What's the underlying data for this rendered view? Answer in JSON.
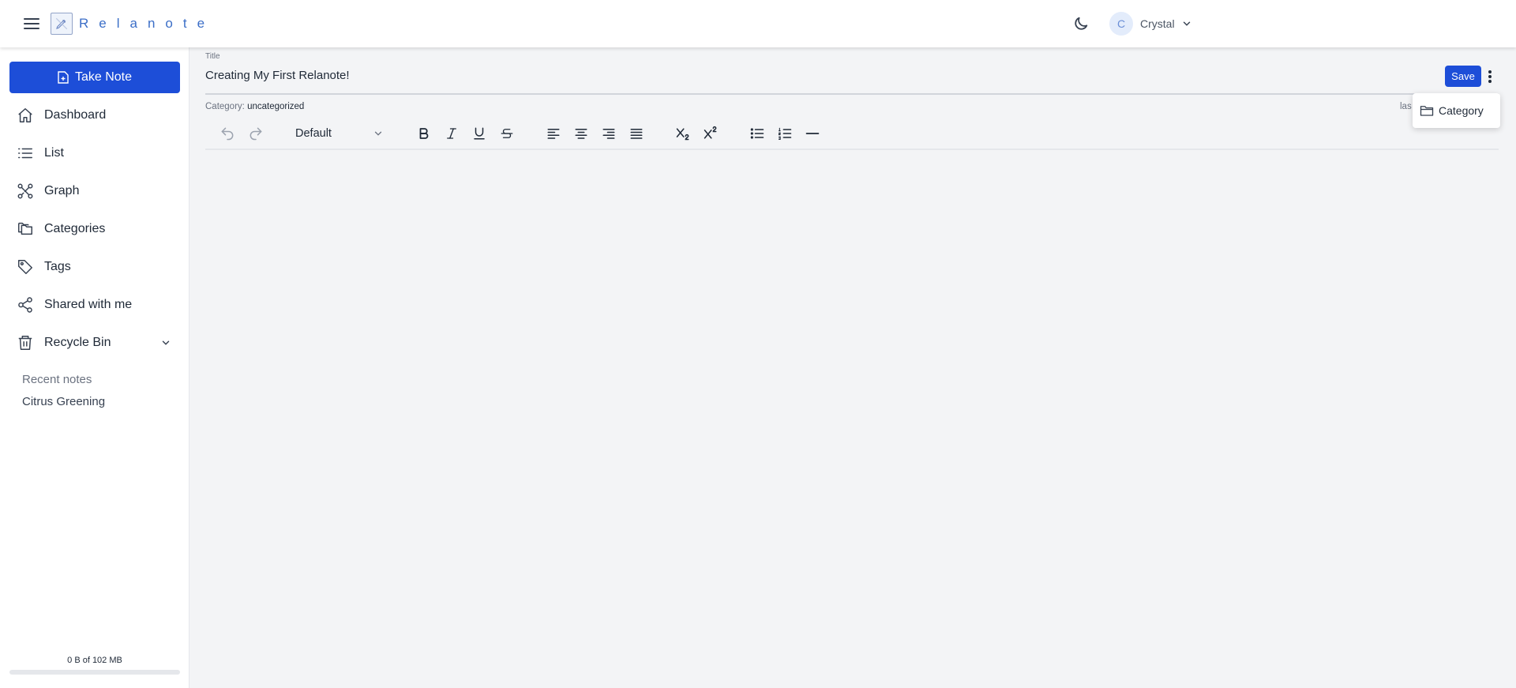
{
  "header": {
    "logo_text": "Relanote",
    "user_initial": "C",
    "user_name": "Crystal"
  },
  "sidebar": {
    "take_note_label": "Take Note",
    "items": [
      {
        "label": "Dashboard",
        "icon": "home-icon"
      },
      {
        "label": "List",
        "icon": "list-icon"
      },
      {
        "label": "Graph",
        "icon": "graph-icon"
      },
      {
        "label": "Categories",
        "icon": "folders-icon"
      },
      {
        "label": "Tags",
        "icon": "tag-icon"
      },
      {
        "label": "Shared with me",
        "icon": "share-icon"
      },
      {
        "label": "Recycle Bin",
        "icon": "trash-icon"
      }
    ],
    "recent_heading": "Recent notes",
    "recent_notes": [
      "Citrus Greening"
    ],
    "storage_text": "0 B of 102 MB",
    "storage_used_fraction": 0
  },
  "editor": {
    "title_label": "Title",
    "title_value": "Creating My First Relanote!",
    "save_label": "Save",
    "category_label": "Category:",
    "category_value": "uncategorized",
    "last_edited_fragment": "las",
    "menu_items": [
      {
        "label": "Category",
        "icon": "folder-icon"
      }
    ],
    "format_value": "Default"
  },
  "colors": {
    "primary": "#1d4ed8",
    "background": "#f3f4f6",
    "sidebar_bg": "#ffffff"
  }
}
